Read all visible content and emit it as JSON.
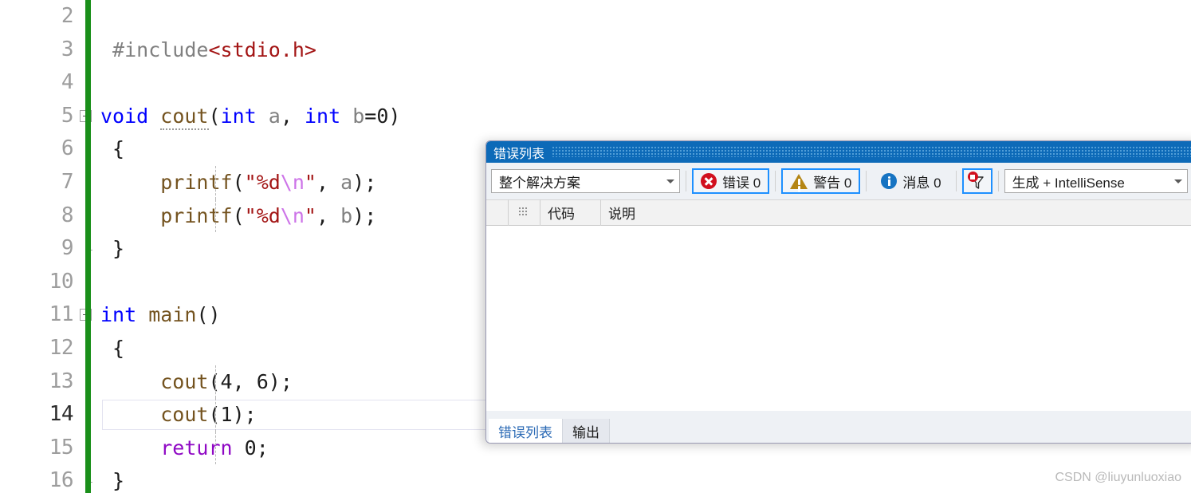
{
  "editor": {
    "change_bar_color": "#1a8f1a",
    "current_line": 14,
    "lines": [
      {
        "no": "2",
        "text": ""
      },
      {
        "no": "3",
        "text": "#include<stdio.h>"
      },
      {
        "no": "4",
        "text": ""
      },
      {
        "no": "5",
        "text": "void cout(int a, int b=0)"
      },
      {
        "no": "6",
        "text": "{"
      },
      {
        "no": "7",
        "text": "    printf(\"%d\\n\", a);"
      },
      {
        "no": "8",
        "text": "    printf(\"%d\\n\", b);"
      },
      {
        "no": "9",
        "text": "}"
      },
      {
        "no": "10",
        "text": ""
      },
      {
        "no": "11",
        "text": "int main()"
      },
      {
        "no": "12",
        "text": "{"
      },
      {
        "no": "13",
        "text": "    cout(4, 6);"
      },
      {
        "no": "14",
        "text": "    cout(1);"
      },
      {
        "no": "15",
        "text": "    return 0;"
      },
      {
        "no": "16",
        "text": "}"
      }
    ]
  },
  "error_list": {
    "title": "错误列表",
    "toolbar": {
      "scope_label": "整个解决方案",
      "errors_label": "错误 0",
      "warnings_label": "警告 0",
      "messages_label": "消息 0",
      "filter_icon_name": "filter-icon",
      "build_label": "生成 + IntelliSense"
    },
    "columns": [
      {
        "key": "blank",
        "label": ""
      },
      {
        "key": "icon",
        "label": ""
      },
      {
        "key": "code",
        "label": "代码"
      },
      {
        "key": "desc",
        "label": "说明"
      }
    ],
    "rows": [],
    "tabs": [
      {
        "label": "错误列表",
        "active": true
      },
      {
        "label": "输出",
        "active": false
      }
    ]
  },
  "watermark": "CSDN @liuyunluoxiao",
  "colors": {
    "title_bar": "#0d6ab8",
    "error_red": "#d10f1e",
    "warning_gold": "#b48514",
    "info_blue": "#1673c2",
    "focus_blue": "#1e90ff",
    "change_bar_green": "#1a8f1a"
  }
}
